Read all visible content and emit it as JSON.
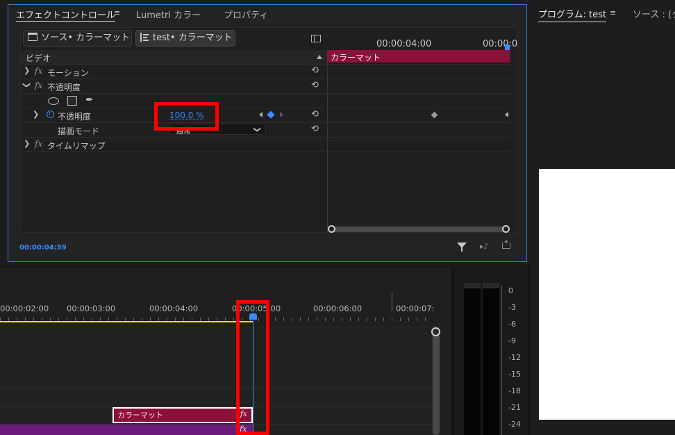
{
  "effect_controls": {
    "tabs": [
      {
        "label": "エフェクトコントロール",
        "active": true
      },
      {
        "label": "Lumetri カラー"
      },
      {
        "label": "プロパティ"
      }
    ],
    "menu_glyph": "≡",
    "source_chip": "ソース• カラーマット",
    "sequence_chip": "test• カラーマット",
    "sequence_chip_icon": "sequence-icon",
    "section_label": "ビデオ",
    "rows": {
      "motion": "モーション",
      "opacity": "不透明度",
      "opacity_param": "不透明度",
      "opacity_value": "100.0 %",
      "blend_mode_label": "描画モード",
      "blend_mode_value": "通常",
      "time_remap": "タイムリマップ"
    },
    "fx_label": "fx",
    "timecode": "00:00:04:59",
    "mini_timeline": {
      "ruler_labels": [
        "00:00:04:00",
        "00:00:0"
      ],
      "clip_label": "カラーマット",
      "clip_color": "#8d1038"
    }
  },
  "program_monitor": {
    "title": "プログラム: test",
    "menu_glyph": "≡",
    "source_tab": "ソース : (ク"
  },
  "timeline": {
    "ruler_labels": [
      "00:00:02:00",
      "00:00:03:00",
      "00:00:04:00",
      "00:00:05:00",
      "00:00:06:00",
      "00:00:07:"
    ],
    "clip_label": "カラーマット",
    "clip_fx": "fx",
    "lower_clip_fx": "fx"
  },
  "audio_meter": {
    "db_labels": [
      "0",
      "-3",
      "-6",
      "-9",
      "-12",
      "-15",
      "-18",
      "-21",
      "-24"
    ]
  },
  "colors": {
    "accent_blue": "#3a7bc8",
    "value_blue": "#2f8cff",
    "highlight_red": "#ff0000",
    "clip_crimson": "#8d1038",
    "clip_purple": "#6d1b7b"
  }
}
